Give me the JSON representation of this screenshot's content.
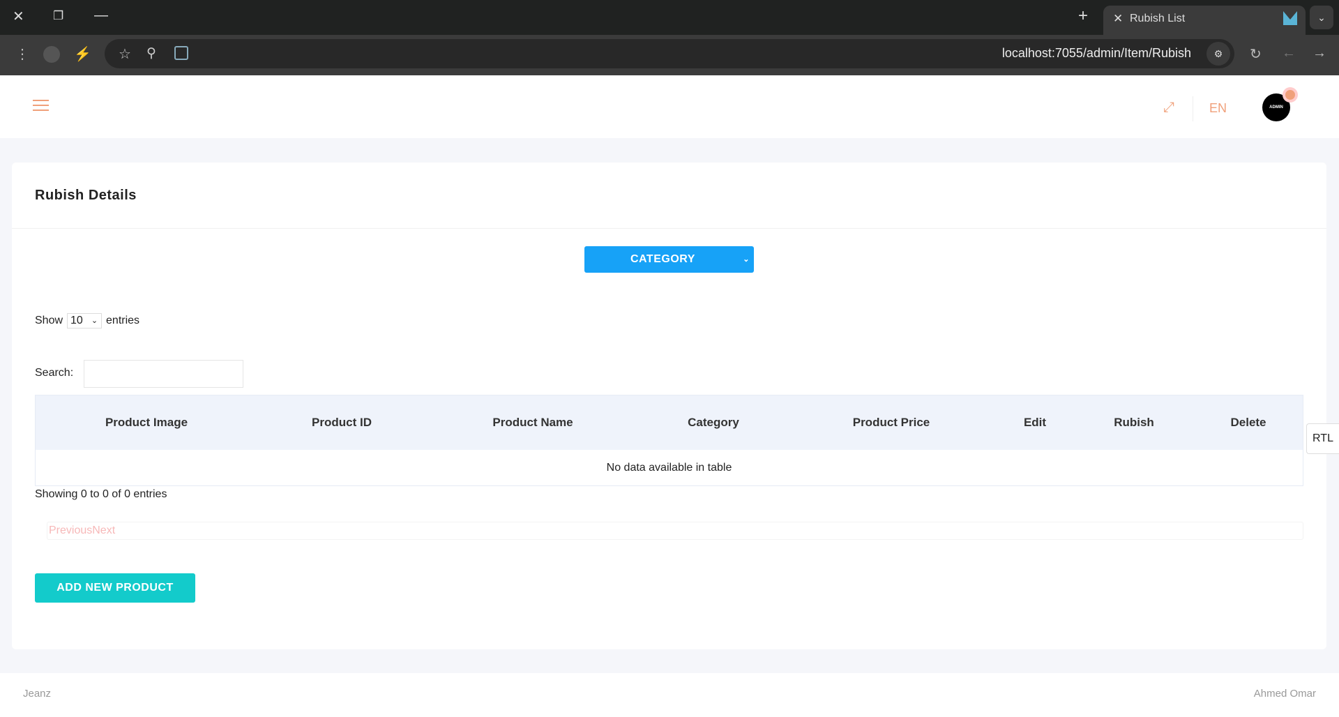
{
  "browser": {
    "tab_title": "Rubish List",
    "url": "localhost:7055/admin/Item/Rubish"
  },
  "header": {
    "language": "EN",
    "avatar_label": "ADMIN"
  },
  "page": {
    "title": "Rubish Details",
    "category_button": "CATEGORY",
    "show_label": "Show",
    "entries_value": "10",
    "entries_label": "entries",
    "search_label": "Search:",
    "search_value": "",
    "columns": [
      "Product Image",
      "Product ID",
      "Product Name",
      "Category",
      "Product Price",
      "Edit",
      "Rubish",
      "Delete"
    ],
    "empty_message": "No data available in table",
    "info": "Showing 0 to 0 of 0 entries",
    "previous": "Previous",
    "next": "Next",
    "add_button": "ADD NEW PRODUCT"
  },
  "rtl_label": "RTL",
  "footer": {
    "left": "Jeanz",
    "right": "Ahmed Omar"
  },
  "colors": {
    "accent": "#f0a07a",
    "category_button": "#17a2f7",
    "add_button": "#13cbcb",
    "table_header": "#eff3fb"
  }
}
